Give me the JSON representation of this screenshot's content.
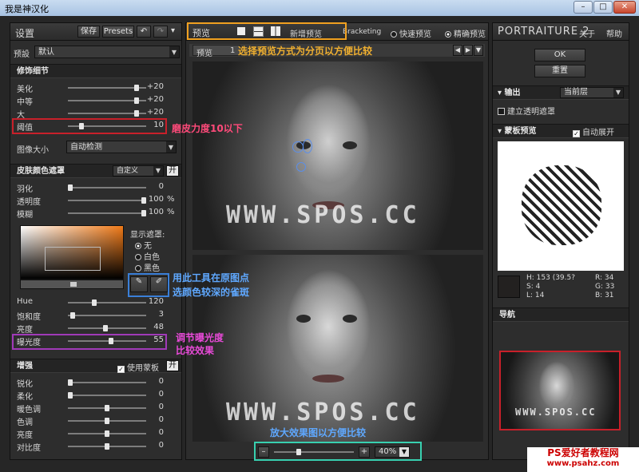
{
  "window": {
    "title": "我是神汉化",
    "min_label": "–",
    "max_label": "□",
    "close_label": "✕"
  },
  "settings": {
    "title": "设置",
    "save_label": "保存",
    "presets_label": "Presets",
    "undo_icon": "undo-icon",
    "redo_icon": "redo-icon",
    "preset_label": "预設",
    "preset_value": "默认"
  },
  "detail": {
    "title": "修饰细节",
    "sliders": [
      {
        "label": "美化",
        "value": "+20",
        "level": 0.9
      },
      {
        "label": "中等",
        "value": "+20",
        "level": 0.9
      },
      {
        "label": "大",
        "value": "+20",
        "level": 0.9
      },
      {
        "label": "阈值",
        "value": "10",
        "level": 0.15
      }
    ],
    "image_size_label": "图像大小",
    "image_size_value": "自动检测"
  },
  "skin": {
    "title": "皮肤颜色遮罩",
    "mode": "自定义",
    "toggle": "开",
    "sliders": [
      {
        "label": "羽化",
        "value": "0",
        "unit": "",
        "level": 0.0
      },
      {
        "label": "透明度",
        "value": "100",
        "unit": "%",
        "level": 1.0
      },
      {
        "label": "模糊",
        "value": "100",
        "unit": "%",
        "level": 1.0
      }
    ],
    "show_mask_label": "显示遮罩:",
    "mask_options": [
      {
        "label": "无",
        "selected": true
      },
      {
        "label": "白色",
        "selected": false
      },
      {
        "label": "黑色",
        "selected": false
      }
    ],
    "sliders2": [
      {
        "label": "Hue",
        "value": "120",
        "level": 0.33
      },
      {
        "label": "饱和度",
        "value": "3",
        "level": 0.03
      },
      {
        "label": "亮度",
        "value": "48",
        "level": 0.48
      },
      {
        "label": "曝光度",
        "value": "55",
        "level": 0.55
      }
    ]
  },
  "enhance": {
    "title": "增强",
    "use_mask_label": "使用蒙板",
    "toggle": "开",
    "sliders": [
      {
        "label": "锐化",
        "value": "0",
        "level": 0.0
      },
      {
        "label": "柔化",
        "value": "0",
        "level": 0.0
      },
      {
        "label": "暖色调",
        "value": "0",
        "level": 0.5
      },
      {
        "label": "色调",
        "value": "0",
        "level": 0.5
      },
      {
        "label": "亮度",
        "value": "0",
        "level": 0.5
      },
      {
        "label": "对比度",
        "value": "0",
        "level": 0.5
      }
    ]
  },
  "preview": {
    "title": "预览",
    "new_preview": "新增预览",
    "bracketing": "Bracketing",
    "quick_preview": "快速预览",
    "precise_preview": "精确预览",
    "tab_label": "预览",
    "tab_number": "1",
    "watermark": "WWW.SPOS.CC",
    "zoom_value": "40%",
    "zoom_minus": "–",
    "zoom_plus": "+",
    "zoom_level": 0.3
  },
  "right": {
    "brand": "PORTRAITURE 2",
    "about": "关于",
    "help": "帮助",
    "ok": "OK",
    "reset": "重置",
    "output_title": "输出",
    "output_value": "当前层",
    "create_mask": "建立透明遮罩",
    "mask_preview_title": "蒙板预览",
    "auto_expand": "自动展开",
    "color_info": {
      "h": "H: 153 (39.5?",
      "s": "S: 4",
      "l": "L: 14",
      "r": "R: 34",
      "g": "G: 33",
      "b": "B: 31"
    },
    "nav_title": "导航"
  },
  "annotations": {
    "preview_mode": "选择预览方式为分页以方便比较",
    "threshold": "磨皮力度10以下",
    "eyedropper_line1": "用此工具在原图点",
    "eyedropper_line2": "选颜色较深的雀斑",
    "exposure_line1": "调节曝光度",
    "exposure_line2": "比较效果",
    "zoom": "放大效果图以方便比较"
  },
  "watermark_site": {
    "line1": "PS爱好者教程网",
    "line2": "www.psahz.com"
  },
  "colors": {
    "red": "#c8202a",
    "blue": "#3a7fd8",
    "purple": "#a03ab8",
    "yellow": "#f0a020",
    "teal": "#38d0b0"
  }
}
